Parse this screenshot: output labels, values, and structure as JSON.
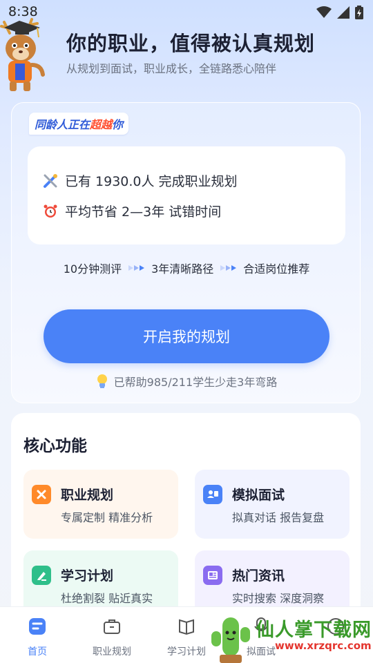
{
  "status_bar": {
    "time": "8:38"
  },
  "hero": {
    "title": "你的职业，值得被认真规划",
    "subtitle": "从规划到面试，职业成长，全链路悉心陪伴"
  },
  "plan_card": {
    "badge": {
      "prefix": "同龄人正在",
      "highlight": "超越",
      "suffix": "你"
    },
    "stats": [
      {
        "icon": "tools-icon",
        "text": "已有 1930.0人 完成职业规划"
      },
      {
        "icon": "alarm-clock-icon",
        "text": "平均节省 2—3年 试错时间"
      }
    ],
    "steps": [
      "10分钟测评",
      "3年清晰路径",
      "合适岗位推荐"
    ],
    "start_button_label": "开启我的规划",
    "helped_note": "已帮助985/211学生少走3年弯路"
  },
  "core_features": {
    "title": "核心功能",
    "items": [
      {
        "title": "职业规划",
        "desc": "专属定制 精准分析",
        "icon": "career-plan-icon",
        "color": "#ff8a2a"
      },
      {
        "title": "模拟面试",
        "desc": "拟真对话 报告复盘",
        "icon": "mock-interview-icon",
        "color": "#4a82f7"
      },
      {
        "title": "学习计划",
        "desc": "杜绝割裂 贴近真实",
        "icon": "study-plan-icon",
        "color": "#2fbf8a"
      },
      {
        "title": "热门资讯",
        "desc": "实时搜索 深度洞察",
        "icon": "news-icon",
        "color": "#8a6cf0"
      }
    ]
  },
  "bottom_nav": {
    "items": [
      {
        "label": "首页",
        "icon": "home-icon",
        "active": true
      },
      {
        "label": "职业规划",
        "icon": "briefcase-icon",
        "active": false
      },
      {
        "label": "学习计划",
        "icon": "book-icon",
        "active": false
      },
      {
        "label": "拟面试",
        "icon": "interview-icon",
        "active": false
      },
      {
        "label": "",
        "icon": "profile-icon",
        "active": false
      }
    ]
  },
  "watermark": {
    "text": "仙人掌下载网",
    "url": "www.xrzqrc.com"
  },
  "colors": {
    "accent": "#4a82f7",
    "highlight": "#ff4e2f"
  }
}
